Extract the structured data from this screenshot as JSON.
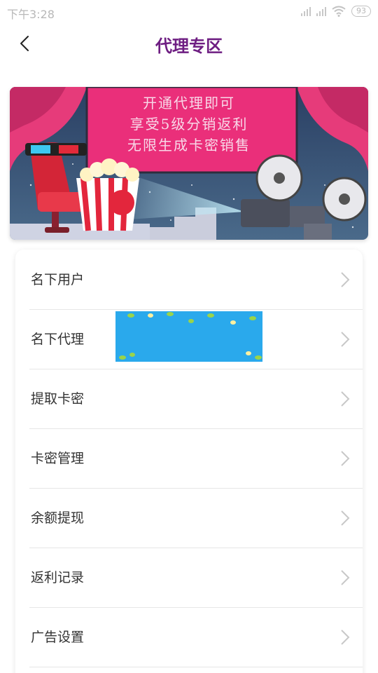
{
  "status_bar": {
    "time": "下午3:28",
    "battery": "93"
  },
  "header": {
    "title": "代理专区"
  },
  "banner": {
    "lines": [
      "开通代理即可",
      "享受5级分销返利",
      "无限生成卡密销售"
    ]
  },
  "menu": {
    "items": [
      {
        "label": "名下用户"
      },
      {
        "label": "名下代理"
      },
      {
        "label": "提取卡密"
      },
      {
        "label": "卡密管理"
      },
      {
        "label": "余额提现"
      },
      {
        "label": "返利记录"
      },
      {
        "label": "广告设置"
      }
    ]
  },
  "colors": {
    "title": "#6e1e82",
    "banner_screen": "#ea2f7a",
    "banner_bg": "#2c4a6e",
    "ad_bg": "#2aa9ec"
  }
}
